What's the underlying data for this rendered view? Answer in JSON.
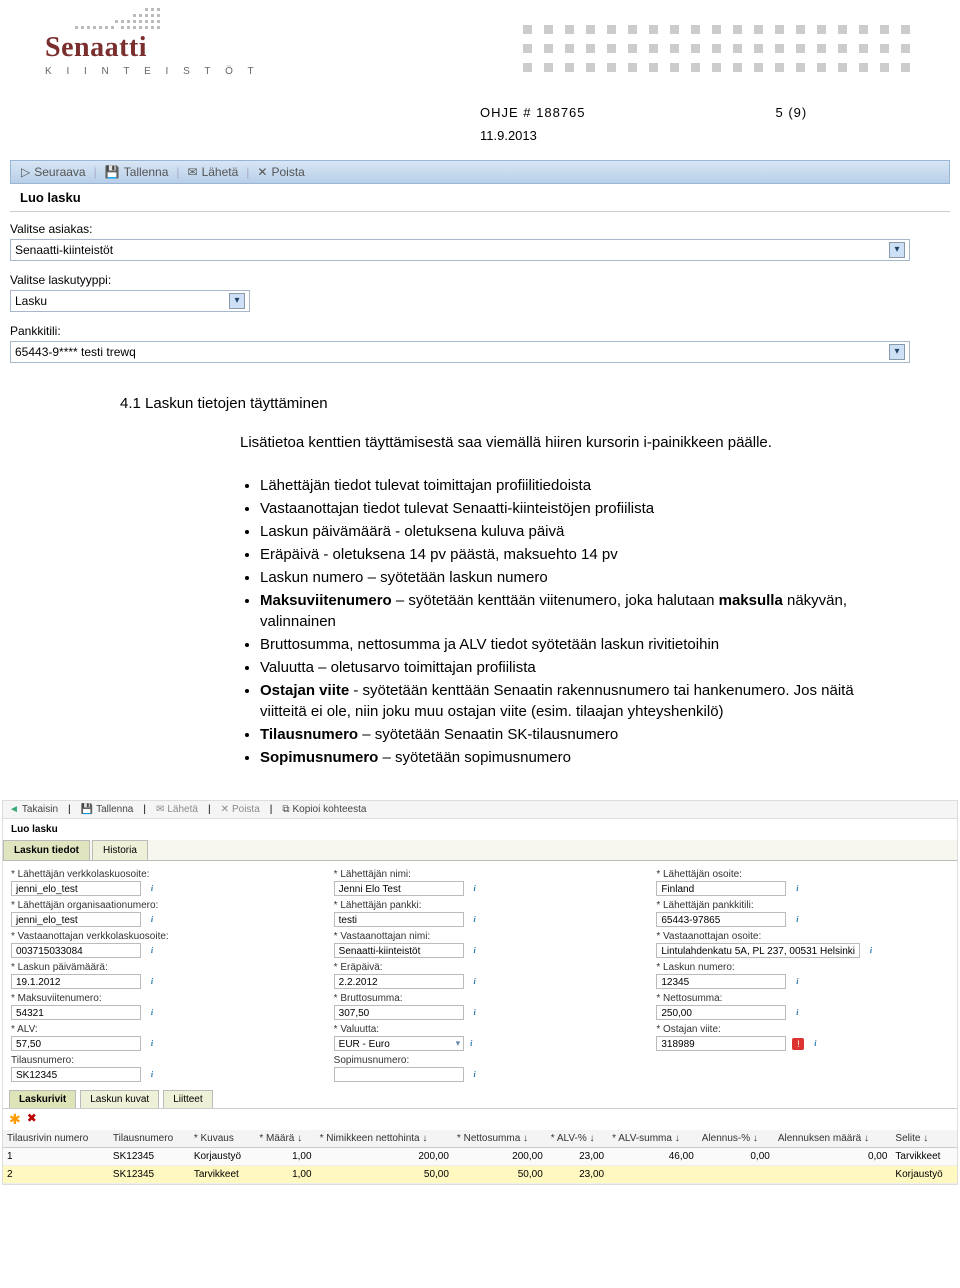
{
  "logo": {
    "name": "Senaatti",
    "sub": "K I I N T E I S T Ö T"
  },
  "doc": {
    "code": "OHJE # 188765",
    "page": "5 (9)",
    "date": "11.9.2013"
  },
  "toolbar1": {
    "next": "Seuraava",
    "save": "Tallenna",
    "send": "Lähetä",
    "delete": "Poista"
  },
  "form1": {
    "title": "Luo lasku",
    "customer_label": "Valitse asiakas:",
    "customer_value": "Senaatti-kiinteistöt",
    "type_label": "Valitse laskutyyppi:",
    "type_value": "Lasku",
    "bank_label": "Pankkitili:",
    "bank_value": "65443-9**** testi trewq"
  },
  "section": {
    "num_title": "4.1 Laskun tietojen täyttäminen",
    "intro": "Lisätietoa kenttien täyttämisestä saa viemällä hiiren kursorin i-painikkeen päälle.",
    "bullets": [
      "Lähettäjän tiedot tulevat toimittajan profiilitiedoista",
      "Vastaanottajan tiedot tulevat Senaatti-kiinteistöjen profiilista",
      "Laskun päivämäärä - oletuksena kuluva päivä",
      "Eräpäivä - oletuksena 14 pv päästä, maksuehto 14 pv",
      "Laskun numero – syötetään laskun numero",
      "<b>Maksuviitenumero</b> – syötetään kenttään viitenumero, joka halutaan <b>maksulla</b> näkyvän, valinnainen",
      "Bruttosumma, nettosumma ja ALV tiedot syötetään laskun rivitietoihin",
      "Valuutta – oletusarvo toimittajan profiilista",
      "<b>Ostajan viite</b> - syötetään kenttään Senaatin rakennusnumero tai hankenumero. Jos näitä viitteitä ei ole, niin joku muu ostajan viite (esim. tilaajan yhteyshenkilö)",
      "<b>Tilausnumero</b> – syötetään Senaatin SK-tilausnumero",
      "<b>Sopimusnumero</b> – syötetään sopimusnumero"
    ]
  },
  "toolbar2": {
    "back": "Takaisin",
    "save": "Tallenna",
    "send": "Lähetä",
    "delete": "Poista",
    "copy": "Kopioi kohteesta"
  },
  "form2": {
    "title": "Luo lasku",
    "tabs": {
      "t1": "Laskun tiedot",
      "t2": "Historia"
    },
    "fields": {
      "f1": {
        "lbl": "* Lähettäjän verkkolaskuosoite:",
        "val": "jenni_elo_test"
      },
      "f2": {
        "lbl": "* Lähettäjän nimi:",
        "val": "Jenni Elo Test"
      },
      "f3": {
        "lbl": "* Lähettäjän osoite:",
        "val": "Finland"
      },
      "f4": {
        "lbl": "* Lähettäjän organisaationumero:",
        "val": "jenni_elo_test"
      },
      "f5": {
        "lbl": "* Lähettäjän pankki:",
        "val": "testi"
      },
      "f6": {
        "lbl": "* Lähettäjän pankkitili:",
        "val": "65443-97865"
      },
      "f7": {
        "lbl": "* Vastaanottajan verkkolaskuosoite:",
        "val": "003715033084"
      },
      "f8": {
        "lbl": "* Vastaanottajan nimi:",
        "val": "Senaatti-kiinteistöt"
      },
      "f9": {
        "lbl": "* Vastaanottajan osoite:",
        "val": "Lintulahdenkatu 5A, PL 237, 00531 Helsinki"
      },
      "f10": {
        "lbl": "* Laskun päivämäärä:",
        "val": "19.1.2012"
      },
      "f11": {
        "lbl": "* Eräpäivä:",
        "val": "2.2.2012"
      },
      "f12": {
        "lbl": "* Laskun numero:",
        "val": "12345"
      },
      "f13": {
        "lbl": "* Maksuviitenumero:",
        "val": "54321"
      },
      "f14": {
        "lbl": "* Bruttosumma:",
        "val": "307,50"
      },
      "f15": {
        "lbl": "* Nettosumma:",
        "val": "250,00"
      },
      "f16": {
        "lbl": "* ALV:",
        "val": "57,50"
      },
      "f17": {
        "lbl": "* Valuutta:",
        "val": "EUR - Euro"
      },
      "f18": {
        "lbl": "* Ostajan viite:",
        "val": "318989"
      },
      "f19": {
        "lbl": "Tilausnumero:",
        "val": "SK12345"
      },
      "f20": {
        "lbl": "Sopimusnumero:",
        "val": ""
      }
    },
    "tabs3": {
      "t1": "Laskurivit",
      "t2": "Laskun kuvat",
      "t3": "Liitteet"
    },
    "cols": {
      "c1": "Tilausrivin numero",
      "c2": "Tilausnumero",
      "c3": "* Kuvaus",
      "c4": "* Määrä ↓",
      "c5": "* Nimikkeen nettohinta ↓",
      "c6": "* Nettosumma ↓",
      "c7": "* ALV-% ↓",
      "c8": "* ALV-summa ↓",
      "c9": "Alennus-% ↓",
      "c10": "Alennuksen määrä ↓",
      "c11": "Selite ↓"
    },
    "rows": [
      {
        "n": "1",
        "til": "SK12345",
        "kuv": "Korjaustyö",
        "maara": "1,00",
        "nnh": "200,00",
        "ns": "200,00",
        "alvp": "23,00",
        "alvs": "46,00",
        "alep": "0,00",
        "alem": "0,00",
        "sel": "Tarvikkeet"
      },
      {
        "n": "2",
        "til": "SK12345",
        "kuv": "Tarvikkeet",
        "maara": "1,00",
        "nnh": "50,00",
        "ns": "50,00",
        "alvp": "23,00",
        "alvs": "",
        "alep": "",
        "alem": "",
        "sel": "Korjaustyö"
      }
    ]
  }
}
